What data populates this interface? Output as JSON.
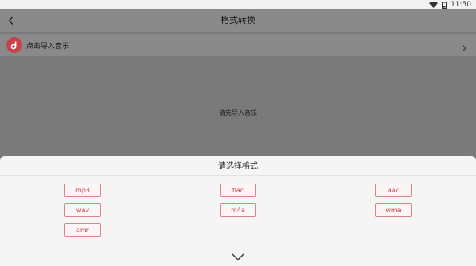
{
  "status_bar": {
    "time": "11:50"
  },
  "app_bar": {
    "title": "格式转换"
  },
  "import_row": {
    "label": "点击导入音乐"
  },
  "empty_hint": "请先导入音乐",
  "sheet": {
    "title": "请选择格式",
    "formats": [
      "mp3",
      "flac",
      "aac",
      "wav",
      "m4a",
      "wma",
      "amr"
    ]
  },
  "colors": {
    "accent": "#c9424a",
    "overlay": "#7a7a7a",
    "sheet_bg": "#f5f5f5"
  }
}
